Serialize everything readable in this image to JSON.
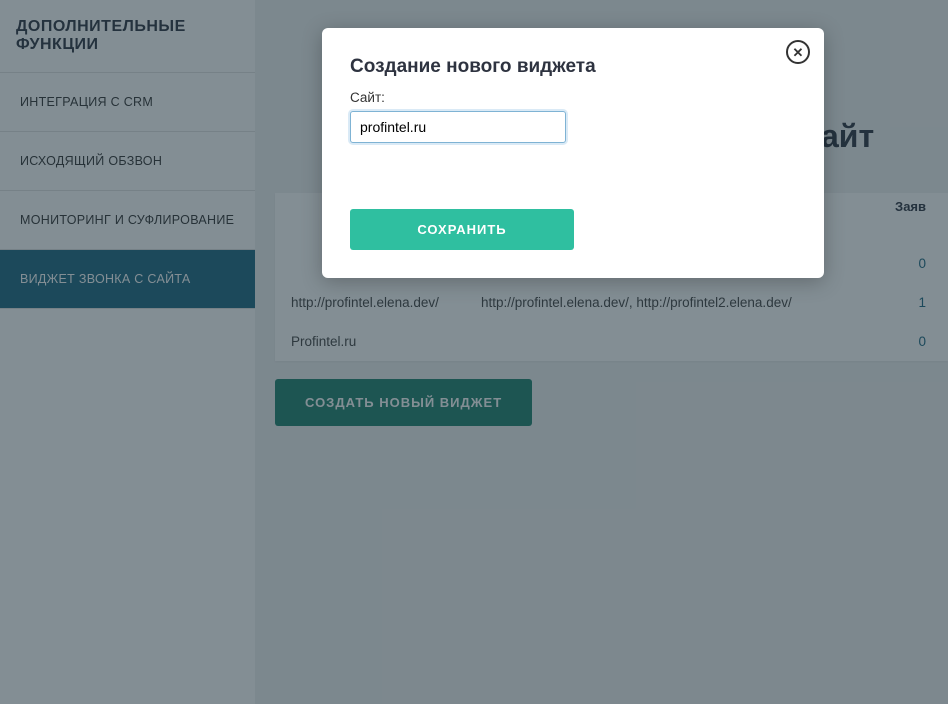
{
  "sidebar": {
    "title": "ДОПОЛНИТЕЛЬНЫЕ ФУНКЦИИ",
    "items": [
      {
        "label": "ИНТЕГРАЦИЯ С CRM"
      },
      {
        "label": "ИСХОДЯЩИЙ ОБЗВОН"
      },
      {
        "label": "МОНИТОРИНГ И СУФЛИРОВАНИЕ"
      },
      {
        "label": "ВИДЖЕТ ЗВОНКА С САЙТА"
      }
    ]
  },
  "main": {
    "page_title_suffix": "айт",
    "create_button": "СОЗДАТЬ НОВЫЙ ВИДЖЕТ",
    "table": {
      "header_requests": "Заяв",
      "rows": [
        {
          "name": "http://profintel.elena.dev/",
          "domains": "http://profintel.elena.dev/, http://profintel2.elena.dev/",
          "requests": "1"
        },
        {
          "name": "Profintel.ru",
          "domains": "",
          "requests": "0"
        }
      ],
      "top_right_value": "0"
    }
  },
  "modal": {
    "title": "Создание нового виджета",
    "label_site": "Сайт:",
    "input_value": "profintel.ru",
    "save_label": "СОХРАНИТЬ"
  }
}
